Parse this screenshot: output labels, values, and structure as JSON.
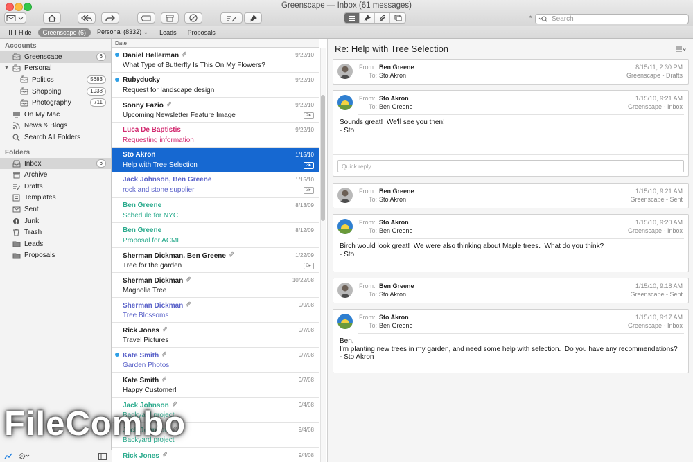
{
  "window": {
    "title": "Greenscape — Inbox (61 messages)"
  },
  "search": {
    "placeholder": "Search"
  },
  "favorites": [
    {
      "label": "Hide"
    },
    {
      "label": "Greenscape (6)"
    },
    {
      "label": "Personal (8332)"
    },
    {
      "label": "Leads"
    },
    {
      "label": "Proposals"
    }
  ],
  "sidebar": {
    "accounts_header": "Accounts",
    "folders_header": "Folders",
    "accounts": [
      {
        "label": "Greenscape",
        "count": "6",
        "icon": "mailbox-icon"
      },
      {
        "label": "Personal",
        "icon": "mailbox-icon"
      },
      {
        "label": "Politics",
        "count": "5683",
        "icon": "mailbox-icon"
      },
      {
        "label": "Shopping",
        "count": "1938",
        "icon": "mailbox-icon"
      },
      {
        "label": "Photography",
        "count": "711",
        "icon": "mailbox-icon"
      },
      {
        "label": "On My Mac",
        "icon": "computer-icon"
      },
      {
        "label": "News & Blogs",
        "icon": "rss-icon"
      },
      {
        "label": "Search All Folders",
        "icon": "search-icon"
      }
    ],
    "folders": [
      {
        "label": "Inbox",
        "count": "6",
        "icon": "inbox-icon"
      },
      {
        "label": "Archive",
        "icon": "archive-icon"
      },
      {
        "label": "Drafts",
        "icon": "drafts-icon"
      },
      {
        "label": "Templates",
        "icon": "templates-icon"
      },
      {
        "label": "Sent",
        "icon": "sent-icon"
      },
      {
        "label": "Junk",
        "icon": "junk-icon"
      },
      {
        "label": "Trash",
        "icon": "trash-icon"
      },
      {
        "label": "Leads",
        "icon": "folder-icon"
      },
      {
        "label": "Proposals",
        "icon": "folder-icon"
      }
    ]
  },
  "list": {
    "date_header": "Date",
    "messages": [
      {
        "from": "Daniel Hellerman",
        "subject": "What Type of Butterfly Is This On My Flowers?",
        "date": "9/22/10",
        "unread": true,
        "attach": true,
        "thread": "",
        "color": "#222222"
      },
      {
        "from": "Rubyducky",
        "subject": "Request for landscape design",
        "date": "9/22/10",
        "unread": true,
        "attach": false,
        "thread": "",
        "color": "#222222"
      },
      {
        "from": "Sonny Fazio",
        "subject": "Upcoming Newsletter Feature Image",
        "date": "9/22/10",
        "unread": false,
        "attach": true,
        "thread": "2",
        "color": "#222222"
      },
      {
        "from": "Luca De Baptistis",
        "subject": "Requesting information",
        "date": "9/22/10",
        "unread": false,
        "attach": false,
        "thread": "",
        "color": "#d2286e"
      },
      {
        "from": "Sto Akron",
        "subject": "Help with Tree Selection",
        "date": "1/15/10",
        "unread": false,
        "attach": false,
        "thread": "3",
        "color": "#ffffff",
        "selected": true
      },
      {
        "from": "Jack Johnson, Ben Greene",
        "subject": "rock and stone supplier",
        "date": "1/15/10",
        "unread": false,
        "attach": false,
        "thread": "3",
        "color": "#5a62c9"
      },
      {
        "from": "Ben Greene",
        "subject": "Schedule for NYC",
        "date": "8/13/09",
        "unread": false,
        "attach": false,
        "thread": "",
        "color": "#2aab8d"
      },
      {
        "from": "Ben Greene",
        "subject": "Proposal for ACME",
        "date": "8/12/09",
        "unread": false,
        "attach": false,
        "thread": "",
        "color": "#2aab8d"
      },
      {
        "from": "Sherman Dickman, Ben Greene",
        "subject": "Tree for the garden",
        "date": "1/22/09",
        "unread": false,
        "attach": true,
        "thread": "3",
        "color": "#222222"
      },
      {
        "from": "Sherman Dickman",
        "subject": "Magnolia Tree",
        "date": "10/22/08",
        "unread": false,
        "attach": true,
        "thread": "",
        "color": "#222222"
      },
      {
        "from": "Sherman Dickman",
        "subject": "Tree Blossoms",
        "date": "9/9/08",
        "unread": false,
        "attach": true,
        "thread": "",
        "color": "#5a62c9"
      },
      {
        "from": "Rick Jones",
        "subject": "Travel Pictures",
        "date": "9/7/08",
        "unread": false,
        "attach": true,
        "thread": "",
        "color": "#222222"
      },
      {
        "from": "Kate Smith",
        "subject": "Garden Photos",
        "date": "9/7/08",
        "unread": true,
        "attach": true,
        "thread": "",
        "color": "#5a62c9"
      },
      {
        "from": "Kate Smith",
        "subject": "Happy Customer!",
        "date": "9/7/08",
        "unread": false,
        "attach": true,
        "thread": "",
        "color": "#222222"
      },
      {
        "from": "Jack Johnson",
        "subject": "Backyard project",
        "date": "9/4/08",
        "unread": false,
        "attach": true,
        "thread": "",
        "color": "#2aab8d"
      },
      {
        "from": "Jack Johnson",
        "subject": "Backyard project",
        "date": "9/4/08",
        "unread": false,
        "attach": true,
        "thread": "",
        "color": "#2aab8d"
      },
      {
        "from": "Rick Jones",
        "subject": "",
        "date": "9/4/08",
        "unread": false,
        "attach": true,
        "thread": "",
        "color": "#2aab8d"
      }
    ]
  },
  "pane": {
    "title": "Re: Help with Tree Selection",
    "from_label": "From:",
    "to_label": "To:",
    "quick_reply": "Quick reply...",
    "cards": [
      {
        "from": "Ben Greene",
        "to": "Sto Akron",
        "date": "8/15/11, 2:30 PM",
        "folder": "Greenscape - Drafts",
        "avatar": "person",
        "body": ""
      },
      {
        "from": "Sto Akron",
        "to": "Ben Greene",
        "date": "1/15/10, 9:21 AM",
        "folder": "Greenscape - Inbox",
        "avatar": "sunset",
        "body": "Sounds great!  We'll see you then!\n- Sto"
      },
      {
        "from": "Ben Greene",
        "to": "Sto Akron",
        "date": "1/15/10, 9:21 AM",
        "folder": "Greenscape - Sent",
        "avatar": "person",
        "body": ""
      },
      {
        "from": "Sto Akron",
        "to": "Ben Greene",
        "date": "1/15/10, 9:20 AM",
        "folder": "Greenscape - Inbox",
        "avatar": "sunset",
        "body": "Birch would look great!  We were also thinking about Maple trees.  What do you think?\n- Sto"
      },
      {
        "from": "Ben Greene",
        "to": "Sto Akron",
        "date": "1/15/10, 9:18 AM",
        "folder": "Greenscape - Sent",
        "avatar": "person",
        "body": ""
      },
      {
        "from": "Sto Akron",
        "to": "Ben Greene",
        "date": "1/15/10, 9:17 AM",
        "folder": "Greenscape - Inbox",
        "avatar": "sunset",
        "body": "Ben,\nI'm planting new trees in my garden, and need some help with selection.  Do you have any recommendations?\n- Sto Akron"
      }
    ]
  },
  "watermark": "FileCombo",
  "colors": {
    "selection": "#1668d1",
    "unread_dot": "#2e9fe6"
  }
}
